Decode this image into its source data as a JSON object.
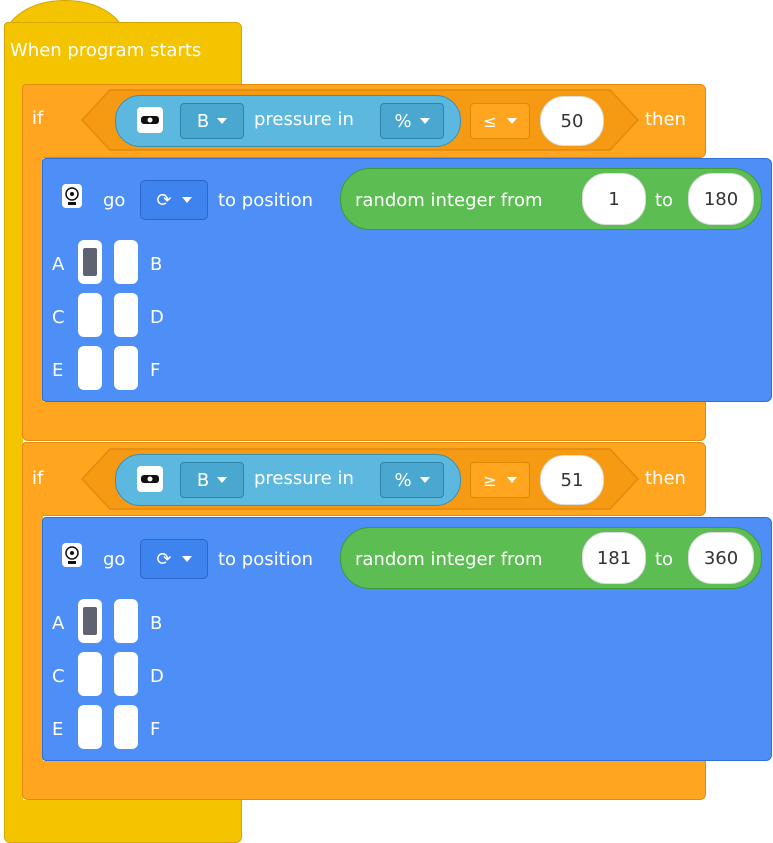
{
  "program": {
    "hat_label": "When program starts",
    "if_label": "if",
    "then_label": "then"
  },
  "blocks": [
    {
      "sensor_port": "B",
      "sensor_label": "pressure in",
      "unit": "%",
      "operator": "≤",
      "compare_value": "50",
      "motor": {
        "go_label": "go",
        "direction_icon": "clockwise-arrow-icon",
        "direction_symbol": "⟳",
        "to_position_label": "to position",
        "random_label": "random integer from",
        "from_value": "1",
        "to_label": "to",
        "to_value": "180",
        "ports": {
          "A": "A",
          "B": "B",
          "C": "C",
          "D": "D",
          "E": "E",
          "F": "F"
        },
        "selected_port": "A"
      }
    },
    {
      "sensor_port": "B",
      "sensor_label": "pressure in",
      "unit": "%",
      "operator": "≥",
      "compare_value": "51",
      "motor": {
        "go_label": "go",
        "direction_icon": "clockwise-arrow-icon",
        "direction_symbol": "⟳",
        "to_position_label": "to position",
        "random_label": "random integer from",
        "from_value": "181",
        "to_label": "to",
        "to_value": "360",
        "ports": {
          "A": "A",
          "B": "B",
          "C": "C",
          "D": "D",
          "E": "E",
          "F": "F"
        },
        "selected_port": "A"
      }
    }
  ],
  "colors": {
    "event_yellow": "#f4c400",
    "control_orange": "#ffa51f",
    "motor_blue": "#4d8ff7",
    "sensor_blue": "#5cb8df",
    "operator_green": "#5cbd52"
  }
}
